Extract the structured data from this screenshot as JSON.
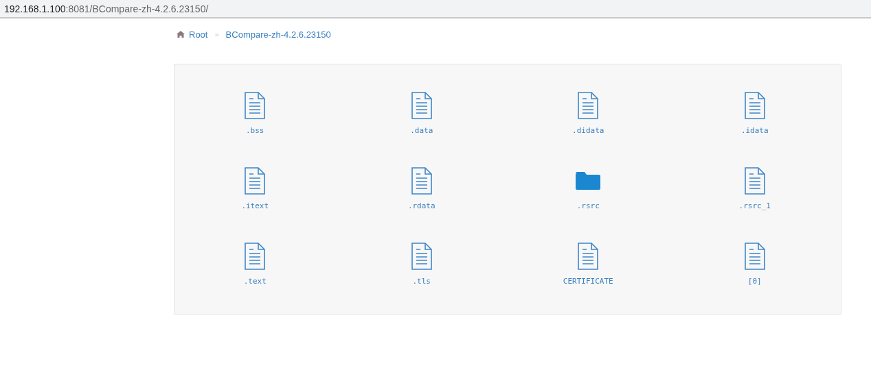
{
  "address_bar": {
    "host": "192.168.1.100",
    "path": ":8081/BCompare-zh-4.2.6.23150/"
  },
  "breadcrumb": {
    "root": "Root",
    "separator": "»",
    "current": "BCompare-zh-4.2.6.23150"
  },
  "items": [
    {
      "name": ".bss",
      "kind": "file"
    },
    {
      "name": ".data",
      "kind": "file"
    },
    {
      "name": ".didata",
      "kind": "file"
    },
    {
      "name": ".idata",
      "kind": "file"
    },
    {
      "name": ".itext",
      "kind": "file"
    },
    {
      "name": ".rdata",
      "kind": "file"
    },
    {
      "name": ".rsrc",
      "kind": "folder"
    },
    {
      "name": ".rsrc_1",
      "kind": "file"
    },
    {
      "name": ".text",
      "kind": "file"
    },
    {
      "name": ".tls",
      "kind": "file"
    },
    {
      "name": "CERTIFICATE",
      "kind": "file"
    },
    {
      "name": "[0]",
      "kind": "file"
    }
  ]
}
